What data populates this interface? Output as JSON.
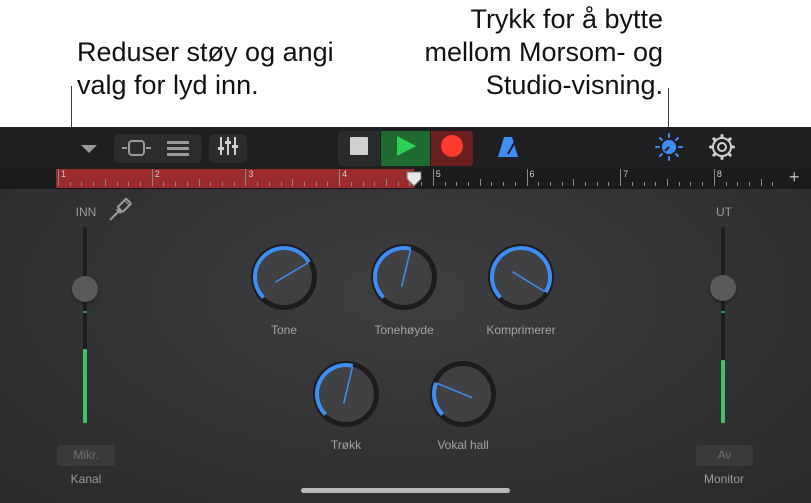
{
  "callouts": {
    "left": "Reduser støy og angi\nvalg for lyd inn.",
    "right": "Trykk for å bytte\nmellom Morsom- og\nStudio-visning."
  },
  "toolbar": {
    "icons": [
      "chevron-down-icon",
      "tracks-view-icon",
      "list-view-icon",
      "mixer-icon",
      "stop-icon",
      "play-icon",
      "record-icon",
      "metronome-icon",
      "view-switch-icon",
      "settings-icon"
    ],
    "colors": {
      "play": "#2ea043",
      "record": "#ff3b30",
      "accent": "#3d8ff5"
    }
  },
  "ruler": {
    "markers": [
      "1",
      "2",
      "3",
      "4",
      "5",
      "6",
      "7",
      "8"
    ],
    "add_label": "+"
  },
  "input": {
    "label": "INN",
    "level": 0.38,
    "button_label": "Mikr.",
    "caption": "Kanal"
  },
  "output": {
    "label": "UT",
    "level": 0.32,
    "button_label": "Av",
    "caption": "Monitor"
  },
  "knobs": [
    {
      "name": "Tone",
      "value": 0.72
    },
    {
      "name": "Tonehøyde",
      "value": 0.55
    },
    {
      "name": "Komprimerer",
      "value": 0.95
    },
    {
      "name": "Trøkk",
      "value": 0.55
    },
    {
      "name": "Vokal hall",
      "value": 0.25
    }
  ]
}
